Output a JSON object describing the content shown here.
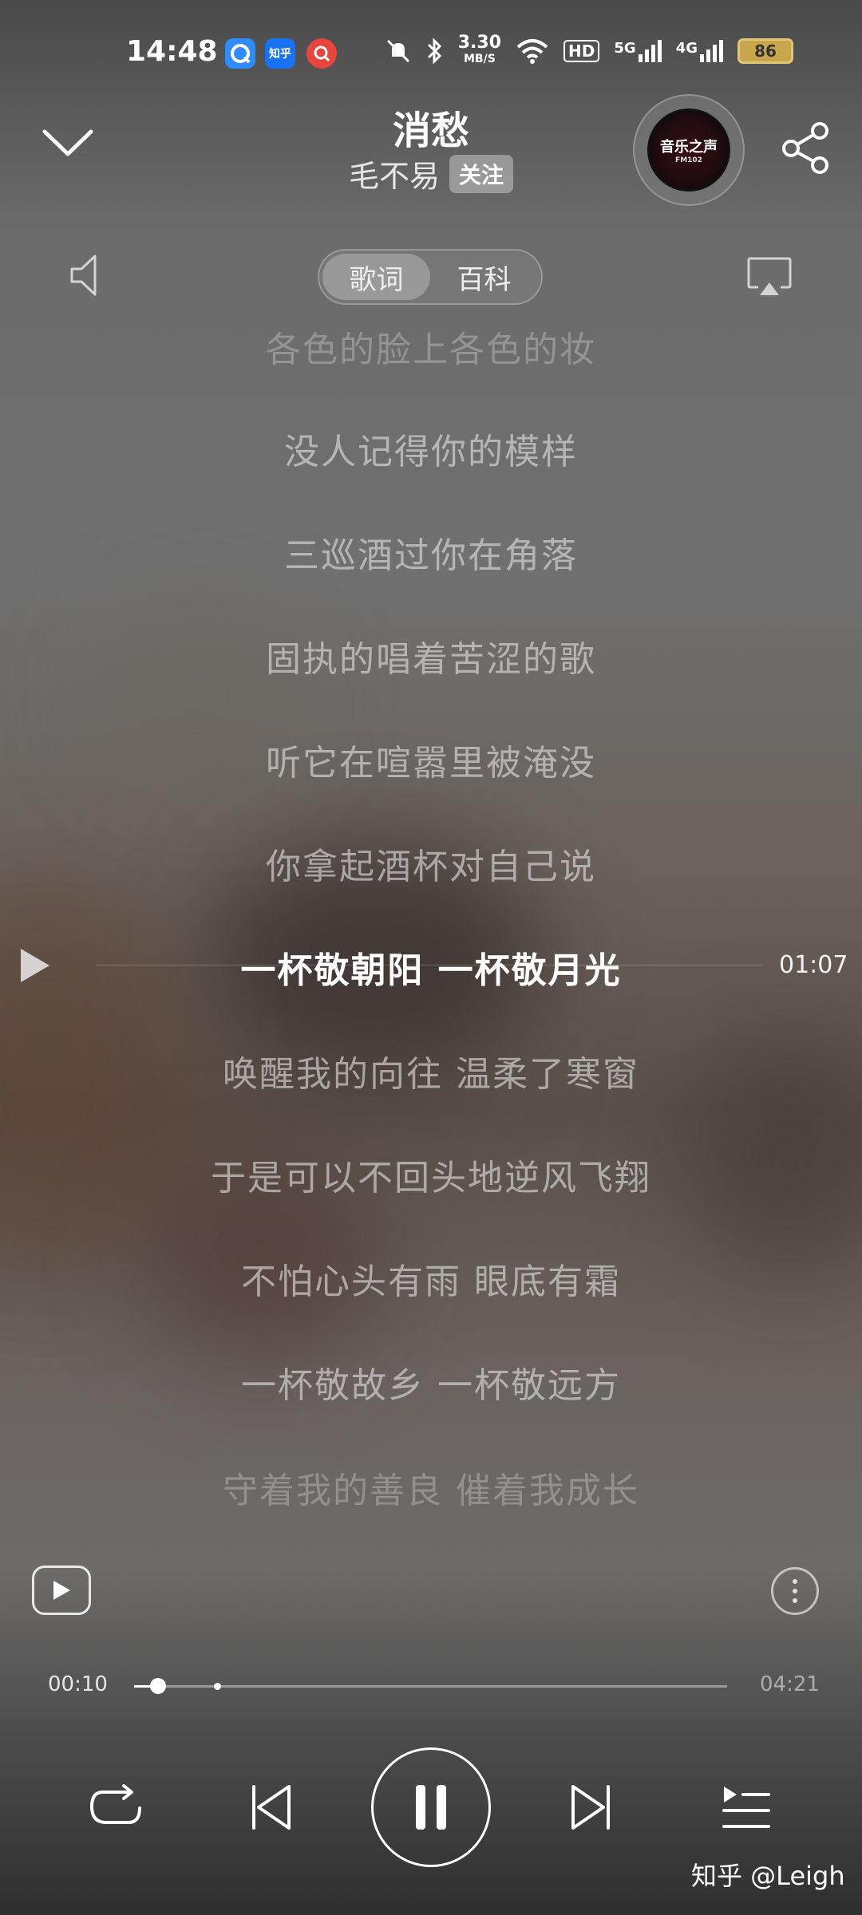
{
  "status_bar": {
    "time": "14:48",
    "app_icons": [
      {
        "name": "qq-browser-icon",
        "text": "",
        "color": "#2f8cff"
      },
      {
        "name": "zhihu-icon",
        "text": "知乎",
        "color": "#1772f6"
      },
      {
        "name": "search-app-icon",
        "text": "",
        "color": "#e8453c"
      }
    ],
    "speed": "3.30",
    "speed_unit": "MB/S",
    "hd": "HD",
    "net1": "5G",
    "net2": "4G",
    "battery": "86"
  },
  "header": {
    "song_title": "消愁",
    "artist": "毛不易",
    "follow_label": "关注",
    "disc_label": "音乐之声",
    "disc_sub": "FM102"
  },
  "tabs": [
    {
      "label": "歌词",
      "active": true
    },
    {
      "label": "百科",
      "active": false
    }
  ],
  "lyrics": {
    "lines": [
      "各色的脸上各色的妆",
      "没人记得你的模样",
      "三巡酒过你在角落",
      "固执的唱着苦涩的歌",
      "听它在喧嚣里被淹没",
      "你拿起酒杯对自己说",
      "一杯敬朝阳 一杯敬月光",
      "唤醒我的向往 温柔了寒窗",
      "于是可以不回头地逆风飞翔",
      "不怕心头有雨 眼底有霜",
      "一杯敬故乡 一杯敬远方",
      "守着我的善良 催着我成长"
    ],
    "current_index": 6,
    "seek_time": "01:07"
  },
  "player": {
    "current_time": "00:10",
    "total_time": "04:21",
    "progress": 0.04,
    "buffer": 0.14
  },
  "watermark": "知乎 @Leigh"
}
